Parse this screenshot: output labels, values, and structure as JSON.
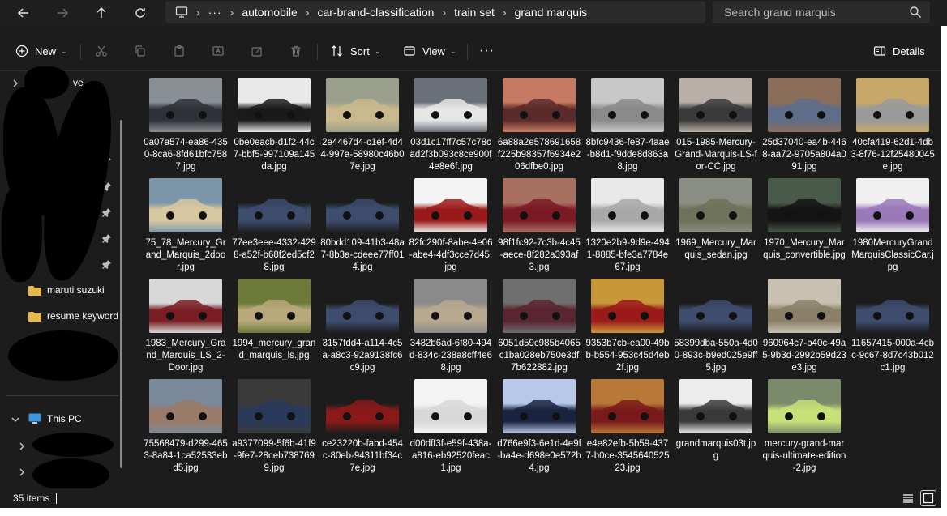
{
  "address": {
    "breadcrumbs": [
      "automobile",
      "car-brand-classification",
      "train set",
      "grand marquis"
    ],
    "more_label": "···"
  },
  "search": {
    "placeholder": "Search grand marquis"
  },
  "toolbar": {
    "new_label": "New",
    "sort_label": "Sort",
    "view_label": "View",
    "more_label": "···",
    "details_label": "Details"
  },
  "sidebar": {
    "top_partial": "ve",
    "quick_partial": "s",
    "folders": [
      "maruti suzuki",
      "resume keyword"
    ],
    "this_pc": "This PC"
  },
  "files": [
    {
      "name": "0a07a574-ea86-4350-8ca6-8fd61bfc7587.jpg",
      "colors": [
        "#8a8f94",
        "#2f3236"
      ]
    },
    {
      "name": "0be0eacb-d1f2-44c7-bbf5-997109a145da.jpg",
      "colors": [
        "#e8e8e8",
        "#1a1a1a"
      ]
    },
    {
      "name": "2e4467d4-c1ef-4d44-997a-58980c46b07e.jpg",
      "colors": [
        "#9aa08c",
        "#c9b98c"
      ]
    },
    {
      "name": "03d1c17ff7c57c78cad2f3b093c8ce900f4e8e6f.jpg",
      "colors": [
        "#6a7078",
        "#e6e6e6"
      ]
    },
    {
      "name": "6a88a2e578691658f225b98357f6934e206dfbe0.jpg",
      "colors": [
        "#c77a63",
        "#5a2a2a"
      ]
    },
    {
      "name": "8bfc9436-fe87-4aae-b8d1-f9dde8d863a8.jpg",
      "colors": [
        "#c8c8c8",
        "#8a8a8a"
      ]
    },
    {
      "name": "015-1985-Mercury-Grand-Marquis-LS-for-CC.jpg",
      "colors": [
        "#b8b0a8",
        "#3a3a3a"
      ]
    },
    {
      "name": "25d37040-ea4b-4468-aa72-9705a804a091.jpg",
      "colors": [
        "#8a6e5a",
        "#5e6d8a"
      ]
    },
    {
      "name": "40cfa419-62d1-4db3-8f76-12f25480045e.jpg",
      "colors": [
        "#c8a868",
        "#9a9a9a"
      ]
    },
    {
      "name": "75_78_Mercury_Grand_Marquis_2door.jpg",
      "colors": [
        "#7a96a8",
        "#d8c8a0"
      ]
    },
    {
      "name": "77ee3eee-4332-4298-a52f-b68f2ed5cf28.jpg",
      "colors": [
        "#1c1c1c",
        "#3e4d6e"
      ]
    },
    {
      "name": "80bdd109-41b3-48a7-8b3a-cdeee77ff014.jpg",
      "colors": [
        "#1c1c1c",
        "#3e4d6e"
      ]
    },
    {
      "name": "82fc290f-8abe-4e06-abe4-4df3cce7d45.jpg",
      "colors": [
        "#f4f4f4",
        "#9a1a1a"
      ]
    },
    {
      "name": "98f1fc92-7c3b-4c45-aece-8f282a393af3.jpg",
      "colors": [
        "#a87060",
        "#7a1a24"
      ]
    },
    {
      "name": "1320e2b9-9d9e-4941-8885-bfe3a7784e67.jpg",
      "colors": [
        "#e8e8e8",
        "#a8a8a8"
      ]
    },
    {
      "name": "1969_Mercury_Marquis_sedan.jpg",
      "colors": [
        "#8a8e84",
        "#6e7258"
      ]
    },
    {
      "name": "1970_Mercury_Marquis_convertible.jpg",
      "colors": [
        "#4a5a4a",
        "#141414"
      ]
    },
    {
      "name": "1980MercuryGrandMarquisClassicCar.jpg",
      "colors": [
        "#f0f0f0",
        "#9a78b8"
      ]
    },
    {
      "name": "1983_Mercury_Grand_Marquis_LS_2-Door.jpg",
      "colors": [
        "#d8d8d8",
        "#7a1e24"
      ]
    },
    {
      "name": "1994_mercury_grand_marquis_ls.jpg",
      "colors": [
        "#6e7a3a",
        "#b8a87a"
      ]
    },
    {
      "name": "3157fdd4-a114-4c5a-a8c3-92a9138fc6c9.jpg",
      "colors": [
        "#1c1c1c",
        "#3e4d6e"
      ]
    },
    {
      "name": "3482b6ad-6f80-494d-834c-238a8cff4e68.jpg",
      "colors": [
        "#8a8a8a",
        "#b8a890"
      ]
    },
    {
      "name": "6051d59c985b4065c1ba028eb750e3df7b622882.jpg",
      "colors": [
        "#6e6e6e",
        "#5a2430"
      ]
    },
    {
      "name": "9353b7cb-ea00-49bb-b554-953c45d4eb2f.jpg",
      "colors": [
        "#c89838",
        "#9a1a1a"
      ]
    },
    {
      "name": "58399dba-550a-4d00-893c-b9ed025e9ff5.jpg",
      "colors": [
        "#1c1c1c",
        "#3e4d6e"
      ]
    },
    {
      "name": "960964c7-b40c-49a5-9b3d-2992b59d23e3.jpg",
      "colors": [
        "#c8c0b0",
        "#8a806a"
      ]
    },
    {
      "name": "11657415-000a-4cbc-9c67-8d7c43b012c1.jpg",
      "colors": [
        "#1c1c1c",
        "#3e4d6e"
      ]
    },
    {
      "name": "75568479-d299-4653-8a84-1ca52533ebd5.jpg",
      "colors": [
        "#7a8a9a",
        "#9a7a68"
      ]
    },
    {
      "name": "a9377099-5f6b-41f9-9fe7-28ceb7387699.jpg",
      "colors": [
        "#3a3a3a",
        "#2a3a5a"
      ]
    },
    {
      "name": "ce23220b-fabd-454c-80eb-94311bf34c7e.jpg",
      "colors": [
        "#1c1c1c",
        "#8a1a1a"
      ]
    },
    {
      "name": "d00dff3f-e59f-438a-a816-eb92520feac1.jpg",
      "colors": [
        "#f4f4f4",
        "#d8d8d8"
      ]
    },
    {
      "name": "d766e9f3-6e1d-4e9f-ba4e-d698e0e572b4.jpg",
      "colors": [
        "#b8c8e8",
        "#1a2440"
      ]
    },
    {
      "name": "e4e82efb-5b59-4377-b0ce-354564052523.jpg",
      "colors": [
        "#b87838",
        "#7a1a1a"
      ]
    },
    {
      "name": "grandmarquis03t.jpg",
      "colors": [
        "#ececec",
        "#3a3a3a"
      ]
    },
    {
      "name": "mercury-grand-marquis-ultimate-edition-2.jpg",
      "colors": [
        "#7a8a6a",
        "#c8e078"
      ]
    }
  ],
  "status": {
    "item_count": "35 items"
  },
  "colors": {
    "window_bg": "#1c1c1c",
    "field_bg": "#2b2b2b",
    "folder": "#e8b84a",
    "pc_icon": "#3a96dd"
  }
}
